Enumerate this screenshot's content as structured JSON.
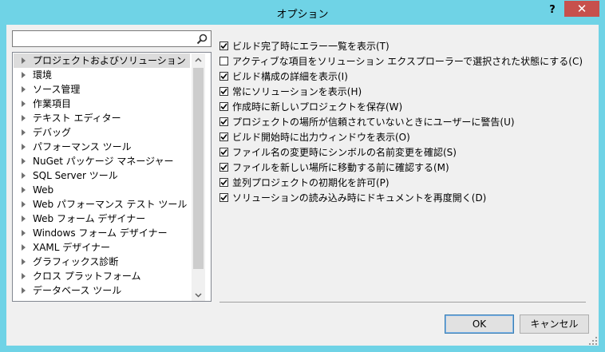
{
  "window": {
    "title": "オプション",
    "help_label": "?",
    "close_label": "✕"
  },
  "search": {
    "placeholder": "",
    "value": ""
  },
  "tree": {
    "items": [
      {
        "label": "プロジェクトおよびソリューション",
        "selected": true
      },
      {
        "label": "環境"
      },
      {
        "label": "ソース管理"
      },
      {
        "label": "作業項目"
      },
      {
        "label": "テキスト エディター"
      },
      {
        "label": "デバッグ"
      },
      {
        "label": "パフォーマンス ツール"
      },
      {
        "label": "NuGet パッケージ マネージャー"
      },
      {
        "label": "SQL Server ツール"
      },
      {
        "label": "Web"
      },
      {
        "label": "Web パフォーマンス テスト ツール"
      },
      {
        "label": "Web フォーム デザイナー"
      },
      {
        "label": "Windows フォーム デザイナー"
      },
      {
        "label": "XAML デザイナー"
      },
      {
        "label": "グラフィックス診断"
      },
      {
        "label": "クロス プラットフォーム"
      },
      {
        "label": "データベース ツール"
      }
    ]
  },
  "options": [
    {
      "label": "ビルド完了時にエラー一覧を表示(T)",
      "checked": true
    },
    {
      "label": "アクティブな項目をソリューション エクスプローラーで選択された状態にする(C)",
      "checked": false
    },
    {
      "label": "ビルド構成の詳細を表示(I)",
      "checked": true
    },
    {
      "label": "常にソリューションを表示(H)",
      "checked": true
    },
    {
      "label": "作成時に新しいプロジェクトを保存(W)",
      "checked": true
    },
    {
      "label": "プロジェクトの場所が信頼されていないときにユーザーに警告(U)",
      "checked": true
    },
    {
      "label": "ビルド開始時に出力ウィンドウを表示(O)",
      "checked": true
    },
    {
      "label": "ファイル名の変更時にシンボルの名前変更を確認(S)",
      "checked": true
    },
    {
      "label": "ファイルを新しい場所に移動する前に確認する(M)",
      "checked": true
    },
    {
      "label": "並列プロジェクトの初期化を許可(P)",
      "checked": true
    },
    {
      "label": "ソリューションの読み込み時にドキュメントを再度開く(D)",
      "checked": true
    }
  ],
  "buttons": {
    "ok_label": "OK",
    "cancel_label": "キャンセル"
  },
  "colors": {
    "titlebar": "#6fd3e6",
    "close": "#c7504c",
    "client": "#f0f0f0",
    "selection": "#dcdcdc"
  }
}
